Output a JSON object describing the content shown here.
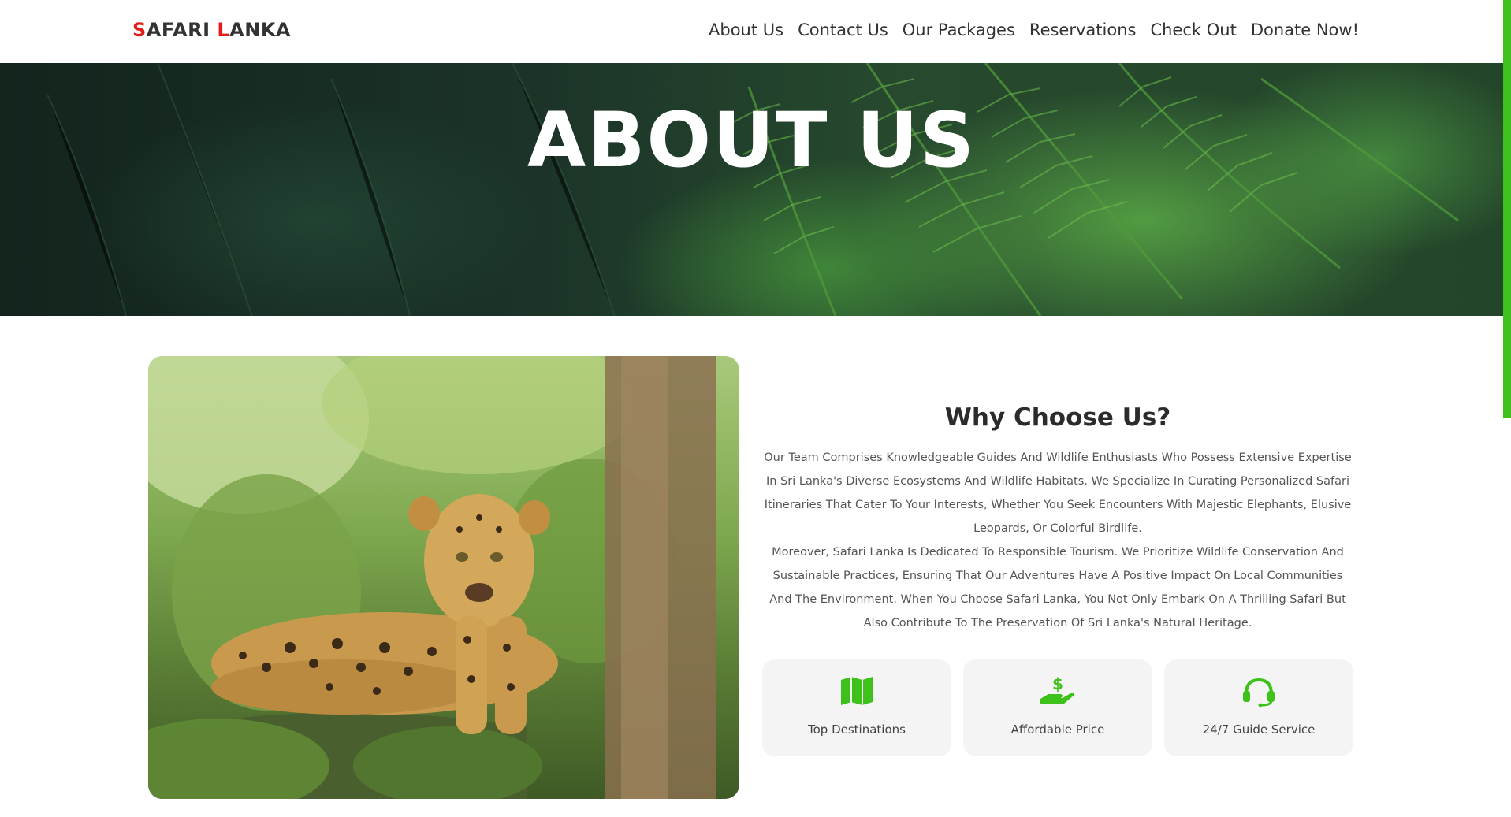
{
  "brand": {
    "logo_s": "S",
    "logo_afari": "AFARI ",
    "logo_l": "L",
    "logo_anka": "ANKA",
    "accent_color": "#e21b1b"
  },
  "nav": {
    "items": [
      {
        "label": "About Us"
      },
      {
        "label": "Contact Us"
      },
      {
        "label": "Our Packages"
      },
      {
        "label": "Reservations"
      },
      {
        "label": "Check Out"
      },
      {
        "label": "Donate Now!"
      }
    ]
  },
  "hero": {
    "title": "ABOUT US",
    "background": "fern-leaves"
  },
  "about": {
    "image": "leopard-in-forest",
    "heading": "Why Choose Us?",
    "paragraph_1": "Our Team Comprises Knowledgeable Guides And Wildlife Enthusiasts Who Possess Extensive Expertise In Sri Lanka's Diverse Ecosystems And Wildlife Habitats. We Specialize In Curating Personalized Safari Itineraries That Cater To Your Interests, Whether You Seek Encounters With Majestic Elephants, Elusive Leopards, Or Colorful Birdlife.",
    "paragraph_2": "Moreover, Safari Lanka Is Dedicated To Responsible Tourism. We Prioritize Wildlife Conservation And Sustainable Practices, Ensuring That Our Adventures Have A Positive Impact On Local Communities And The Environment. When You Choose Safari Lanka, You Not Only Embark On A Thrilling Safari But Also Contribute To The Preservation Of Sri Lanka's Natural Heritage."
  },
  "features": [
    {
      "icon": "map-icon",
      "label": "Top Destinations"
    },
    {
      "icon": "money-hand-icon",
      "label": "Affordable Price"
    },
    {
      "icon": "headset-icon",
      "label": "24/7 Guide Service"
    }
  ],
  "colors": {
    "accent_green": "#3ec21b",
    "card_bg": "#f4f4f4"
  }
}
